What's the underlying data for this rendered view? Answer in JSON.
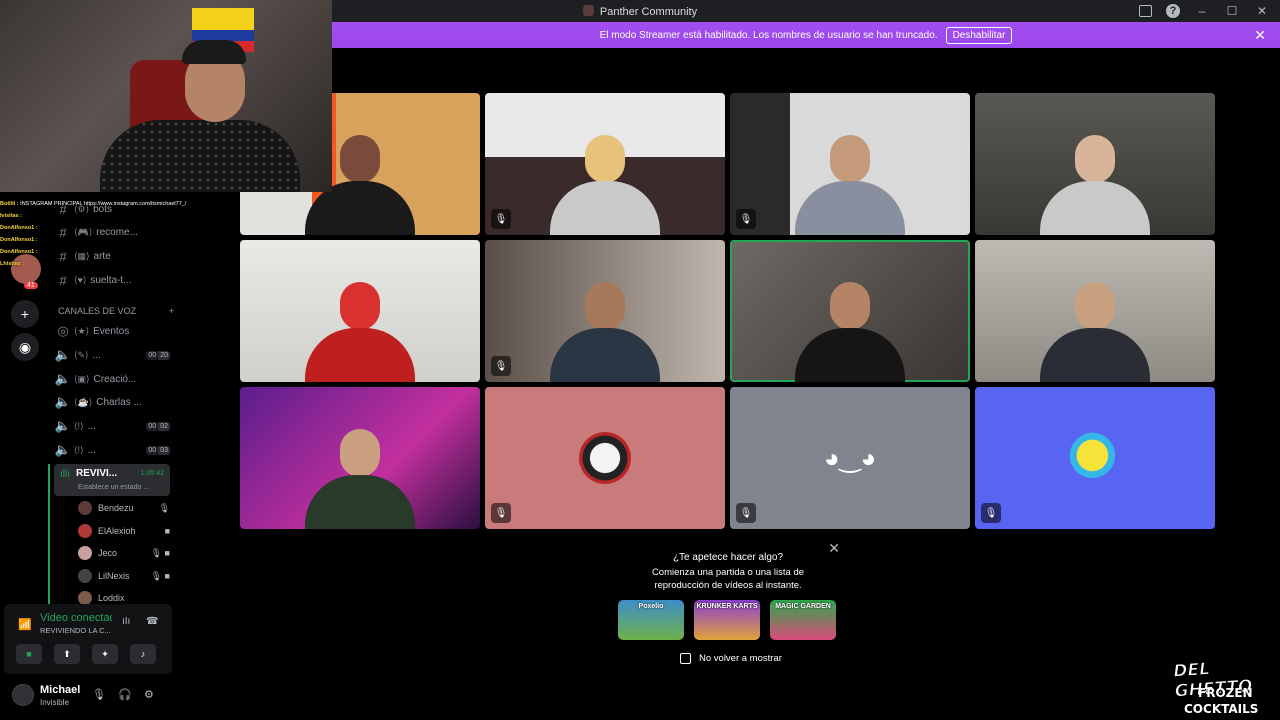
{
  "window": {
    "title": "Panther Community",
    "controls": [
      "minimize-icon",
      "maximize-icon",
      "close-icon"
    ]
  },
  "banner": {
    "text": "El modo Streamer está habilitado. Los nombres de usuario se han truncado.",
    "button": "Deshabilitar"
  },
  "chat_overlay": [
    {
      "user": "Botlili :",
      "msg": "INSTAGRAM PRINCIPAL https://www.instagram.com/itsmichael77_/"
    },
    {
      "user": "Ivisitas :",
      "msg": ""
    },
    {
      "user": "DonAlfonso1 :",
      "msg": ""
    },
    {
      "user": "DonAlfonso1 :",
      "msg": ""
    },
    {
      "user": "DonAlfonso1 :",
      "msg": ""
    },
    {
      "user": "Lhistias :",
      "msg": ""
    }
  ],
  "guilds": {
    "badge": "41"
  },
  "text_channels": [
    {
      "name": "bots",
      "icon": "bot-icon"
    },
    {
      "name": "recome...",
      "icon": "game-icon"
    },
    {
      "name": "arte",
      "icon": "art-icon"
    },
    {
      "name": "suelta-t...",
      "icon": "heart-icon"
    }
  ],
  "voice_category": {
    "label": "CANALES DE VOZ"
  },
  "voice_channels": [
    {
      "name": "Eventos",
      "count": "",
      "limit": ""
    },
    {
      "name": "...",
      "count": "00",
      "limit": "20"
    },
    {
      "name": "Creació...",
      "count": "",
      "limit": ""
    },
    {
      "name": "Charlas ...",
      "count": "",
      "limit": ""
    },
    {
      "name": "...",
      "count": "00",
      "limit": "02"
    },
    {
      "name": "...",
      "count": "00",
      "limit": "03"
    }
  ],
  "active_channel": {
    "name": "REVIVI...",
    "timer": "1:05:42",
    "status": "Establece un estado ..."
  },
  "voice_users": [
    {
      "name": "Bendezu",
      "color": "#5d3a3a"
    },
    {
      "name": "ElAlexioh",
      "color": "#b03a3a"
    },
    {
      "name": "Jeco",
      "color": "#c9a0a0"
    },
    {
      "name": "LilNexis",
      "color": "#444"
    },
    {
      "name": "Loddix",
      "color": "#7a5a4a"
    }
  ],
  "voice_panel": {
    "status": "Video conectado",
    "channel": "REVIVIENDO LA C..."
  },
  "user": {
    "name": "Michael",
    "status": "Invisible"
  },
  "activity": {
    "question": "¿Te apetece hacer algo?",
    "description": "Comienza una partida o una lista de reproducción de vídeos al instante.",
    "games": [
      {
        "name": "Poxelio",
        "color": "#3e8ec9"
      },
      {
        "name": "KRUNKER KARTS",
        "color": "#8a3fd1"
      },
      {
        "name": "MAGIC GARDEN",
        "color": "#2fa84a"
      }
    ],
    "checkbox": "No volver a mostrar"
  },
  "logo": {
    "line1": "DEL GHETTO",
    "line2": "FROZEN",
    "line3": "COCKTAILS"
  },
  "colors": {
    "banner": "#9b46ea",
    "speaking": "#23a55a",
    "tile_pink": "#c97b7b",
    "tile_grey": "#80848e",
    "tile_blurple": "#5865f2"
  }
}
